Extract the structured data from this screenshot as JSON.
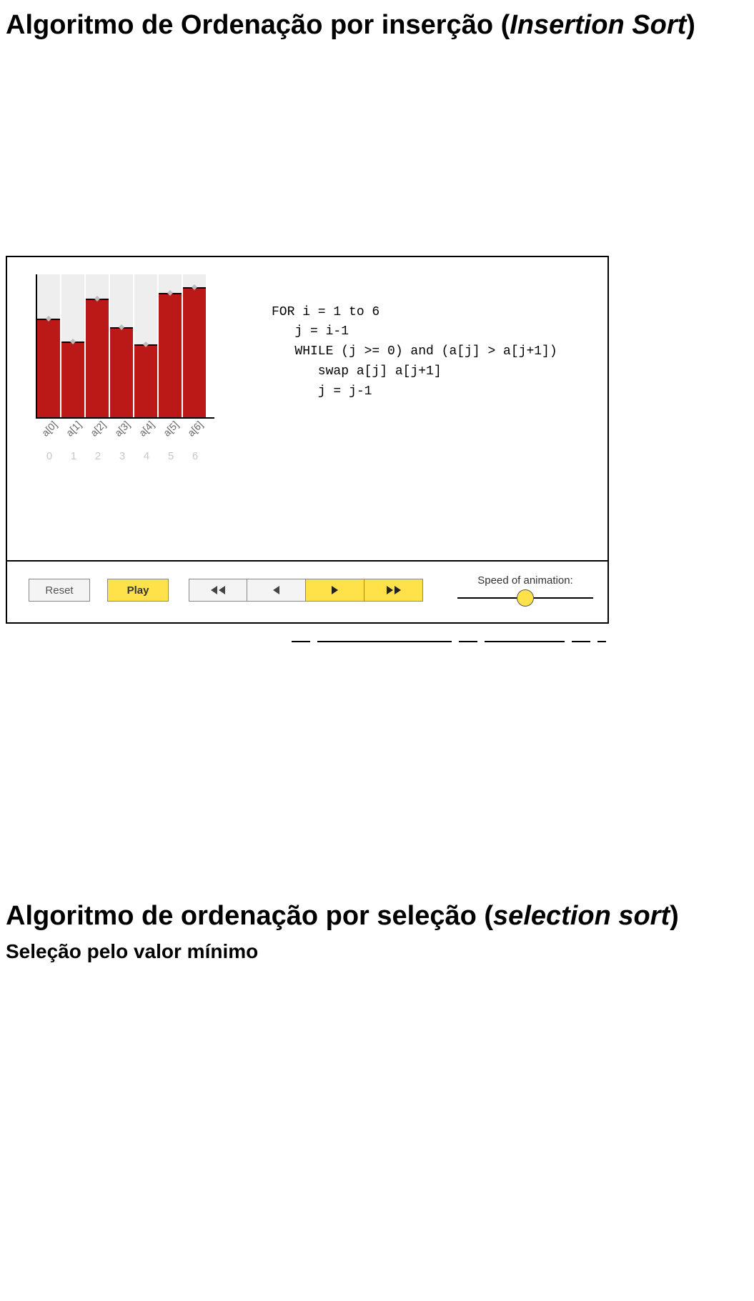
{
  "heading1": {
    "pre": "Algoritmo de Ordenação por inserção (",
    "italic": "Insertion Sort",
    "post": ")"
  },
  "heading2": {
    "pre": "Algoritmo de ordenação por seleção (",
    "italic": "selection sort",
    "post": ")"
  },
  "subheading2": "Seleção pelo valor mínimo",
  "visualizer": {
    "buttons": {
      "reset": "Reset",
      "play": "Play"
    },
    "speed_label": "Speed of animation:",
    "speed_value": 0.5,
    "code": "FOR i = 1 to 6\n   j = i-1\n   WHILE (j >= 0) and (a[j] > a[j+1])\n      swap a[j] a[j+1]\n      j = j-1",
    "axis_labels": [
      "a[0]",
      "a[1]",
      "a[2]",
      "a[3]",
      "a[4]",
      "a[5]",
      "a[6]"
    ],
    "axis_indices": [
      "0",
      "1",
      "2",
      "3",
      "4",
      "5",
      "6"
    ]
  },
  "chart_data": {
    "type": "bar",
    "categories": [
      "a[0]",
      "a[1]",
      "a[2]",
      "a[3]",
      "a[4]",
      "a[5]",
      "a[6]"
    ],
    "values": [
      68,
      52,
      82,
      62,
      50,
      86,
      90
    ],
    "title": "",
    "xlabel": "",
    "ylabel": "",
    "ylim": [
      0,
      100
    ],
    "bar_color": "#bb1818",
    "slot_color": "#eeeeee"
  }
}
